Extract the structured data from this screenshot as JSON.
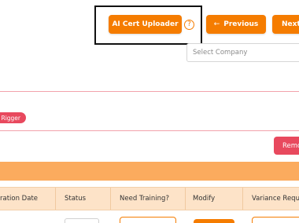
{
  "header": {
    "ai_uploader_label": "AI Cert Uploader",
    "help_icon": "question-circle-icon",
    "help_glyph": "?",
    "previous_label": "Previous",
    "previous_arrow": "←",
    "next_label": "Next",
    "company_select": {
      "placeholder": "Select Company",
      "value": ""
    }
  },
  "tags": {
    "rigger_label": "Rigger"
  },
  "actions": {
    "remove_label": "Remo"
  },
  "table": {
    "headers": [
      "ration Date",
      "Status",
      "Need Training?",
      "Modify",
      "Variance Reque"
    ]
  },
  "colors": {
    "accent": "#f57c00",
    "danger": "#e8495e",
    "band": "#fbab5e",
    "table_header": "#fde3c8"
  }
}
